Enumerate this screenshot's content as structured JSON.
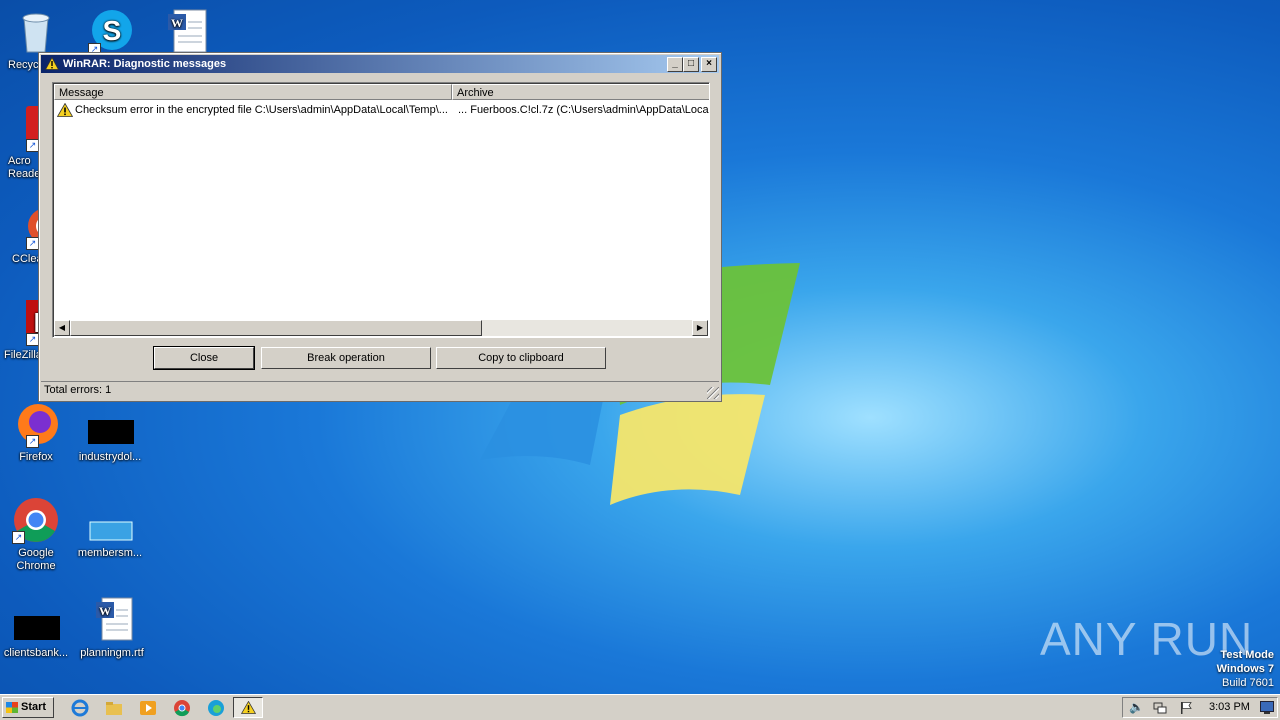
{
  "desktop": {
    "icons": [
      {
        "label": "Recyc",
        "icon": "recycle-bin-icon"
      },
      {
        "label": "",
        "icon": "skype-icon"
      },
      {
        "label": "",
        "icon": "word-document-icon"
      },
      {
        "label": "Acro\nReade",
        "icon": "acrobat-reader-icon"
      },
      {
        "label": "CClea",
        "icon": "ccleaner-icon"
      },
      {
        "label": "FileZilla",
        "icon": "filezilla-icon"
      },
      {
        "label": "Firefox",
        "icon": "firefox-icon"
      },
      {
        "label": "industrydol...",
        "icon": "black-file-icon"
      },
      {
        "label": "Google\nChrome",
        "icon": "chrome-icon"
      },
      {
        "label": "membersm...",
        "icon": "blank-file-icon"
      },
      {
        "label": "clientsbank...",
        "icon": "black-file-icon"
      },
      {
        "label": "planningm.rtf",
        "icon": "word-document-icon"
      }
    ]
  },
  "window": {
    "title": "WinRAR: Diagnostic messages",
    "columns": {
      "message": "Message",
      "archive": "Archive"
    },
    "rows": [
      {
        "message": "Checksum error in the encrypted file C:\\Users\\admin\\AppData\\Local\\Temp\\...",
        "archive": "... Fuerboos.C!cl.7z (C:\\Users\\admin\\AppData\\Loca"
      }
    ],
    "buttons": {
      "close": "Close",
      "break": "Break operation",
      "copy": "Copy to clipboard"
    },
    "status": "Total errors: 1",
    "controls": {
      "minimize": "_",
      "maximize": "□",
      "close": "×"
    }
  },
  "taskbar": {
    "start_label": "Start",
    "clock": "3:03 PM"
  },
  "watermark": {
    "text": "ANY RUN"
  },
  "test_mode": {
    "line1": "Test Mode",
    "line2": "Windows 7",
    "line3": "Build 7601"
  },
  "colors": {
    "title_start": "#0a246a",
    "title_end": "#a6caf0",
    "chrome": "#d4d0c8"
  }
}
